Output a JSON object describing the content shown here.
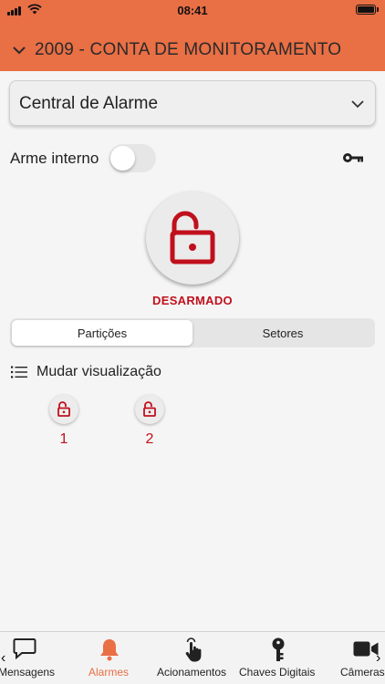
{
  "status_bar": {
    "time": "08:41"
  },
  "header": {
    "title": "2009 - CONTA DE MONITORAMENTO",
    "icon": "chevron-down-icon"
  },
  "dropdown": {
    "selected": "Central de Alarme"
  },
  "arme_interno": {
    "label": "Arme interno",
    "enabled": false
  },
  "alarm": {
    "status": "DESARMADO",
    "icon": "unlocked-padlock-icon",
    "color": "#c0101d"
  },
  "segmented": {
    "tabs": [
      {
        "label": "Partições",
        "active": true
      },
      {
        "label": "Setores",
        "active": false
      }
    ]
  },
  "view_toggle": {
    "label": "Mudar visualização"
  },
  "partitions": [
    {
      "number": "1"
    },
    {
      "number": "2"
    }
  ],
  "tabbar": {
    "items": [
      {
        "label": "Mensagens",
        "icon": "chat-bubble-icon",
        "active": false
      },
      {
        "label": "Alarmes",
        "icon": "bell-icon",
        "active": true
      },
      {
        "label": "Acionamentos",
        "icon": "touch-hand-icon",
        "active": false
      },
      {
        "label": "Chaves Digitais",
        "icon": "key-icon",
        "active": false
      },
      {
        "label": "Câmeras",
        "icon": "video-camera-icon",
        "active": false
      }
    ]
  },
  "colors": {
    "header": "#e96f45",
    "accent": "#c0101d",
    "active_tab": "#e96f45"
  }
}
